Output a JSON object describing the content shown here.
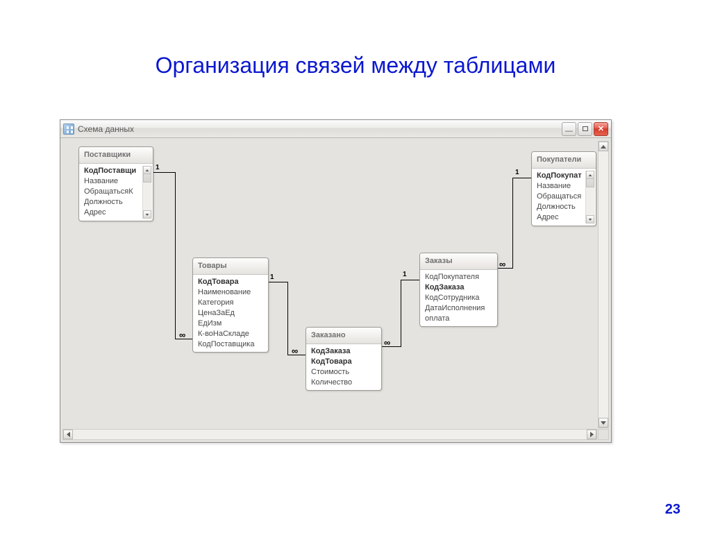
{
  "slide": {
    "title": "Организация связей между таблицами",
    "page_number": "23"
  },
  "window": {
    "title": "Схема данных"
  },
  "tables": {
    "suppliers": {
      "title": "Поставщики",
      "fields": [
        "КодПоставщи",
        "Название",
        "ОбращатьсяК",
        "Должность",
        "Адрес"
      ],
      "pk_indices": [
        0
      ]
    },
    "products": {
      "title": "Товары",
      "fields": [
        "КодТовара",
        "Наименование",
        "Категория",
        "ЦенаЗаЕд",
        "ЕдИзм",
        "К-воНаСкладе",
        "КодПоставщика"
      ],
      "pk_indices": [
        0
      ]
    },
    "ordered": {
      "title": "Заказано",
      "fields": [
        "КодЗаказа",
        "КодТовара",
        "Стоимость",
        "Количество"
      ],
      "pk_indices": [
        0,
        1
      ]
    },
    "orders": {
      "title": "Заказы",
      "fields": [
        "КодПокупателя",
        "КодЗаказа",
        "КодСотрудника",
        "ДатаИсполнения",
        "оплата"
      ],
      "pk_indices": [
        1
      ]
    },
    "customers": {
      "title": "Покупатели",
      "fields": [
        "КодПокупат",
        "Название",
        "Обращаться",
        "Должность",
        "Адрес"
      ],
      "pk_indices": [
        0
      ]
    }
  },
  "relations": {
    "one": "1",
    "many": "∞"
  }
}
